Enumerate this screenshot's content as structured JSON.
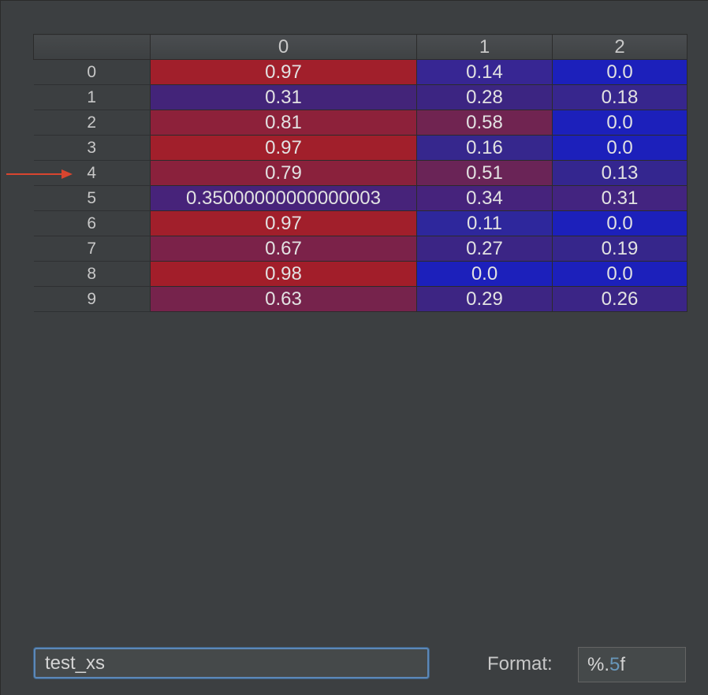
{
  "table": {
    "columns": [
      "0",
      "1",
      "2"
    ],
    "rows": [
      {
        "index": "0",
        "cells": [
          "0.97",
          "0.14",
          "0.0"
        ],
        "colors": [
          "#a11f2b",
          "#372693",
          "#1c20bb"
        ]
      },
      {
        "index": "1",
        "cells": [
          "0.31",
          "0.28",
          "0.18"
        ],
        "colors": [
          "#432479",
          "#3c2582",
          "#37268d"
        ]
      },
      {
        "index": "2",
        "cells": [
          "0.81",
          "0.58",
          "0.0"
        ],
        "colors": [
          "#8d213a",
          "#702451",
          "#1c20bb"
        ]
      },
      {
        "index": "3",
        "cells": [
          "0.97",
          "0.16",
          "0.0"
        ],
        "colors": [
          "#a11f2b",
          "#36278d",
          "#1c20bb"
        ]
      },
      {
        "index": "4",
        "cells": [
          "0.79",
          "0.51",
          "0.13"
        ],
        "colors": [
          "#8a213c",
          "#6a2457",
          "#34268f"
        ]
      },
      {
        "index": "5",
        "cells": [
          "0.35000000000000003",
          "0.34",
          "0.31"
        ],
        "colors": [
          "#47237a",
          "#46237c",
          "#432480"
        ]
      },
      {
        "index": "6",
        "cells": [
          "0.97",
          "0.11",
          "0.0"
        ],
        "colors": [
          "#a11f2b",
          "#2e279c",
          "#1c20bb"
        ]
      },
      {
        "index": "7",
        "cells": [
          "0.67",
          "0.27",
          "0.19"
        ],
        "colors": [
          "#7b2249",
          "#3b2585",
          "#36268b"
        ]
      },
      {
        "index": "8",
        "cells": [
          "0.98",
          "0.0",
          "0.0"
        ],
        "colors": [
          "#a21e2a",
          "#1c20bb",
          "#1c20bb"
        ]
      },
      {
        "index": "9",
        "cells": [
          "0.63",
          "0.29",
          "0.26"
        ],
        "colors": [
          "#76234c",
          "#3d2583",
          "#3b2586"
        ]
      }
    ],
    "selected_row_marker": "4"
  },
  "annotation": {
    "arrow_color": "#d9452f",
    "icon": "arrow-right-icon"
  },
  "footer": {
    "name_value": "test_xs",
    "format_label": "Format:",
    "format_prefix": "%.",
    "format_number": "5",
    "format_suffix": "f"
  }
}
